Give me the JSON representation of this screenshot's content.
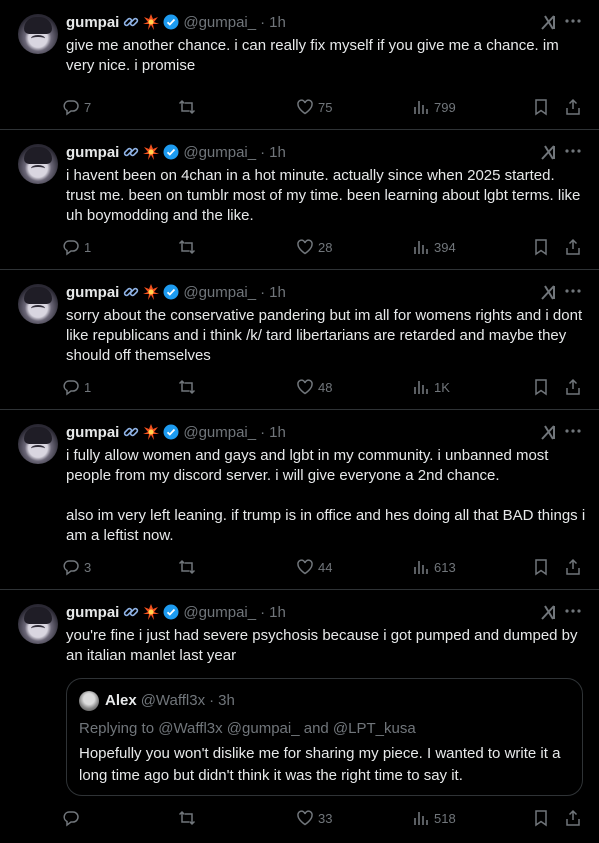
{
  "author": {
    "name": "gumpai",
    "handle": "@gumpai_",
    "dot": "·",
    "time": "1h"
  },
  "tweets": [
    {
      "text": "give me another chance. i can really fix myself if you give me a chance. im very nice. i promise",
      "replies": "7",
      "retweets": "",
      "likes": "75",
      "views": "799"
    },
    {
      "text": "i havent been on 4chan in a hot minute. actually since when 2025 started. trust me. been on tumblr most of my time. been learning about lgbt terms. like uh boymodding and the like.",
      "replies": "1",
      "retweets": "",
      "likes": "28",
      "views": "394"
    },
    {
      "text": "sorry about the conservative pandering but im all for womens rights and i dont like republicans and i think /k/ tard libertarians are retarded and maybe they should off themselves",
      "replies": "1",
      "retweets": "",
      "likes": "48",
      "views": "1K"
    },
    {
      "text": "i fully allow women and gays and lgbt in my community. i unbanned most people from my discord server. i will give everyone a 2nd chance.\n\nalso im very left leaning. if trump is in office and hes doing all that BAD things i am a leftist now.",
      "replies": "3",
      "retweets": "",
      "likes": "44",
      "views": "613"
    },
    {
      "text": "you're fine i just had severe psychosis because i got pumped and dumped by an italian manlet last year",
      "replies": "",
      "retweets": "",
      "likes": "33",
      "views": "518"
    }
  ],
  "quote": {
    "name": "Alex",
    "handle": "@Waffl3x",
    "dot": "·",
    "time": "3h",
    "replying_to": "Replying to @Waffl3x @gumpai_ and @LPT_kusa",
    "text": "Hopefully you won't dislike me for sharing my piece. I wanted to write it a long time ago but didn't think it was the right time to say it."
  },
  "colors": {
    "background": "#000000",
    "text": "#e7e9ea",
    "muted": "#71767b",
    "border": "#2f3336",
    "verified": "#1d9bf0"
  },
  "icons": [
    "link-emoji-icon",
    "collision-emoji-icon",
    "verified-badge-icon",
    "grok-icon",
    "more-icon",
    "reply-icon",
    "retweet-icon",
    "like-icon",
    "views-icon",
    "bookmark-icon",
    "share-icon"
  ]
}
